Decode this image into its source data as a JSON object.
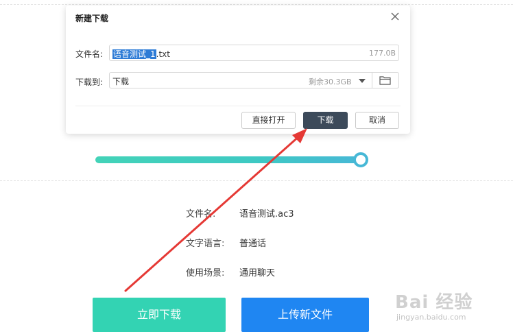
{
  "dialog": {
    "title": "新建下载",
    "filename_label": "文件名:",
    "filename_selected": "语音测试_1",
    "filename_ext": ".txt",
    "file_size": "177.0B",
    "download_to_label": "下载到:",
    "download_location": "下载",
    "free_space": "剩余30.3GB",
    "buttons": {
      "open_direct": "直接打开",
      "download": "下载",
      "cancel": "取消"
    }
  },
  "slider": {
    "value_fraction": 1.0
  },
  "info": {
    "filename_label": "文件名:",
    "filename_value": "语音测试.ac3",
    "language_label": "文字语言:",
    "language_value": "普通话",
    "scene_label": "使用场景:",
    "scene_value": "通用聊天"
  },
  "actions": {
    "download_now": "立即下载",
    "upload_new": "上传新文件"
  },
  "watermark": {
    "brand": "Bai 经验",
    "url": "jingyan.baidu.com"
  },
  "colors": {
    "accent_green": "#33d3b3",
    "accent_blue": "#1f86f2",
    "dark_button": "#3c4a5a",
    "annotation_arrow": "#e53935"
  }
}
